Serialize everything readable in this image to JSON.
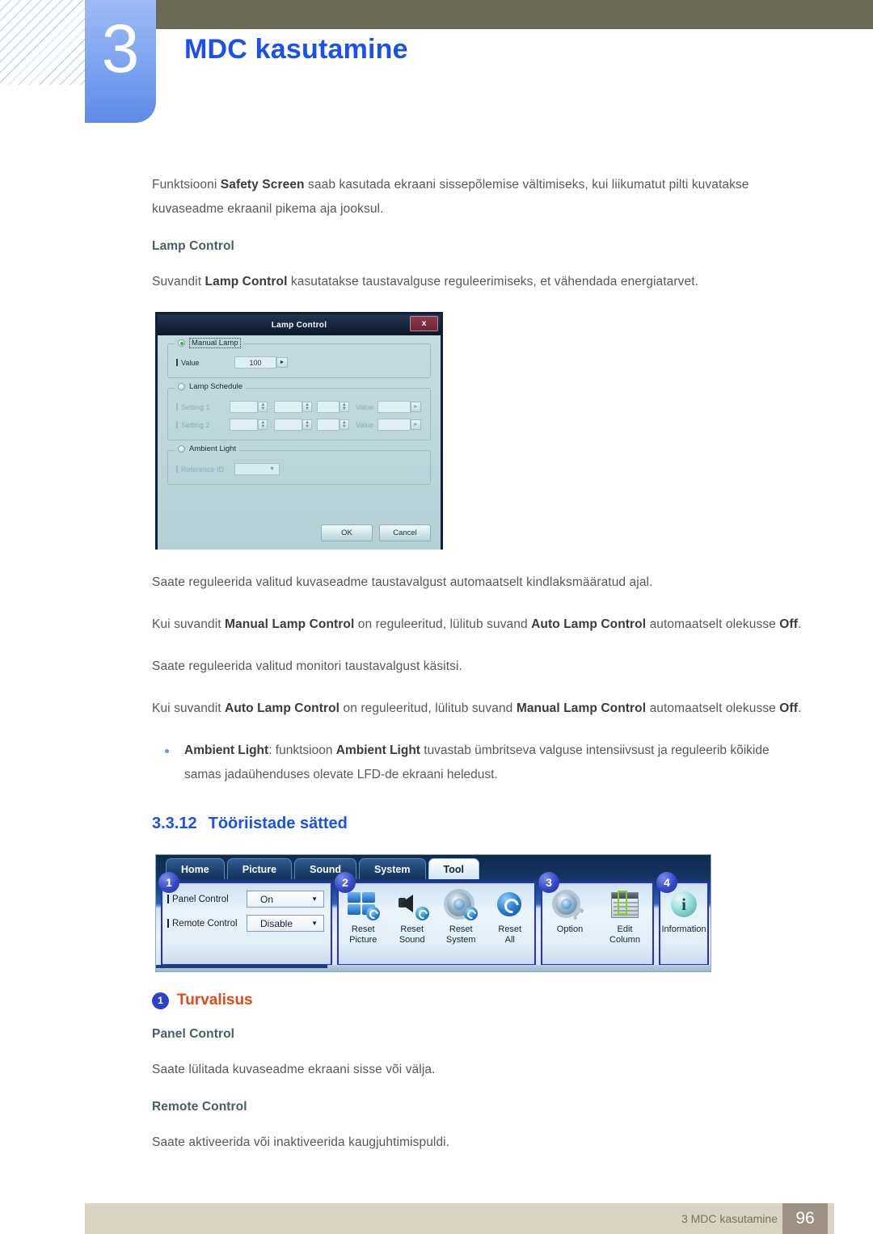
{
  "header": {
    "chapter_number": "3",
    "chapter_title": "MDC kasutamine"
  },
  "intro": {
    "para1_pre": "Funktsiooni ",
    "para1_bold": "Safety Screen",
    "para1_post": " saab kasutada ekraani sissepõlemise vältimiseks, kui liikumatut pilti kuvatakse kuvaseadme ekraanil pikema aja jooksul."
  },
  "lamp_section": {
    "heading": "Lamp Control",
    "desc_pre": "Suvandit ",
    "desc_bold": "Lamp Control",
    "desc_post": " kasutatakse taustavalguse reguleerimiseks, et vähendada energiatarvet."
  },
  "lamp_dialog": {
    "title": "Lamp Control",
    "close_label": "x",
    "manual_lamp": {
      "label": "Manual Lamp",
      "value_label": "Value",
      "value": "100",
      "spinner_glyph": "►"
    },
    "lamp_schedule": {
      "label": "Lamp Schedule",
      "setting1_label": "Setting 1",
      "setting2_label": "Setting 2",
      "value_label": "Value",
      "colon": ":",
      "spin_up": "▲",
      "spin_down": "▼",
      "spinner_glyph": "►"
    },
    "ambient_light": {
      "label": "Ambient Light",
      "reference_id_label": "Reference ID",
      "caret": "▼"
    },
    "ok_label": "OK",
    "cancel_label": "Cancel"
  },
  "lamp_notes": {
    "note1": "Saate reguleerida valitud kuvaseadme taustavalgust automaatselt kindlaksmääratud ajal.",
    "note2_pre": "Kui suvandit ",
    "note2_b1": "Manual Lamp Control",
    "note2_mid": " on reguleeritud, lülitub suvand ",
    "note2_b2": "Auto Lamp Control",
    "note2_post": " automaatselt olekusse ",
    "note2_b3": "Off",
    "note2_end": ".",
    "note3": "Saate reguleerida valitud monitori taustavalgust käsitsi.",
    "note4_pre": "Kui suvandit ",
    "note4_b1": "Auto Lamp Control",
    "note4_mid": " on reguleeritud, lülitub suvand ",
    "note4_b2": "Manual Lamp Control",
    "note4_post": " automaatselt olekusse ",
    "note4_b3": "Off",
    "note4_end": ".",
    "bullet_b1": "Ambient Light",
    "bullet_mid": ": funktsioon ",
    "bullet_b2": "Ambient Light",
    "bullet_post": " tuvastab ümbritseva valguse intensiivsust ja reguleerib kõikide samas jadaühenduses olevate LFD-de ekraani heledust."
  },
  "tools_section": {
    "number": "3.3.12",
    "title": "Tööriistade sätted"
  },
  "ribbon": {
    "tabs": [
      {
        "label": "Home",
        "active": false
      },
      {
        "label": "Picture",
        "active": false
      },
      {
        "label": "Sound",
        "active": false
      },
      {
        "label": "System",
        "active": false
      },
      {
        "label": "Tool",
        "active": true
      }
    ],
    "badges": [
      "1",
      "2",
      "3",
      "4"
    ],
    "panel1": {
      "rows": [
        {
          "label": "Panel Control",
          "value": "On",
          "caret": "▼"
        },
        {
          "label": "Remote Control",
          "value": "Disable",
          "caret": "▼"
        }
      ]
    },
    "panel2": {
      "items": [
        {
          "caption_line1": "Reset",
          "caption_line2": "Picture",
          "icon": "reset-picture-icon"
        },
        {
          "caption_line1": "Reset",
          "caption_line2": "Sound",
          "icon": "reset-sound-icon"
        },
        {
          "caption_line1": "Reset",
          "caption_line2": "System",
          "icon": "reset-system-icon"
        },
        {
          "caption_line1": "Reset",
          "caption_line2": "All",
          "icon": "reset-all-icon"
        }
      ]
    },
    "panel3": {
      "items": [
        {
          "caption_line1": "Option",
          "caption_line2": "",
          "icon": "option-gear-icon"
        },
        {
          "caption_line1": "Edit",
          "caption_line2": "Column",
          "icon": "edit-column-icon"
        }
      ]
    },
    "panel4": {
      "items": [
        {
          "caption_line1": "Information",
          "caption_line2": "",
          "icon": "information-icon"
        }
      ]
    }
  },
  "security": {
    "badge": "1",
    "title": "Turvalisus",
    "panel_control_heading": "Panel Control",
    "panel_control_text": "Saate lülitada kuvaseadme ekraani sisse või välja.",
    "remote_control_heading": "Remote Control",
    "remote_control_text": "Saate aktiveerida või inaktiveerida kaugjuhtimispuldi."
  },
  "footer": {
    "text": "3 MDC kasutamine",
    "page": "96"
  },
  "colors": {
    "accent_blue": "#1a4ff0",
    "callout_orange": "#e04a17",
    "olive_bar": "#6b6a56",
    "footer_bar": "#d9d3c1",
    "footer_page_box": "#9c9184"
  }
}
